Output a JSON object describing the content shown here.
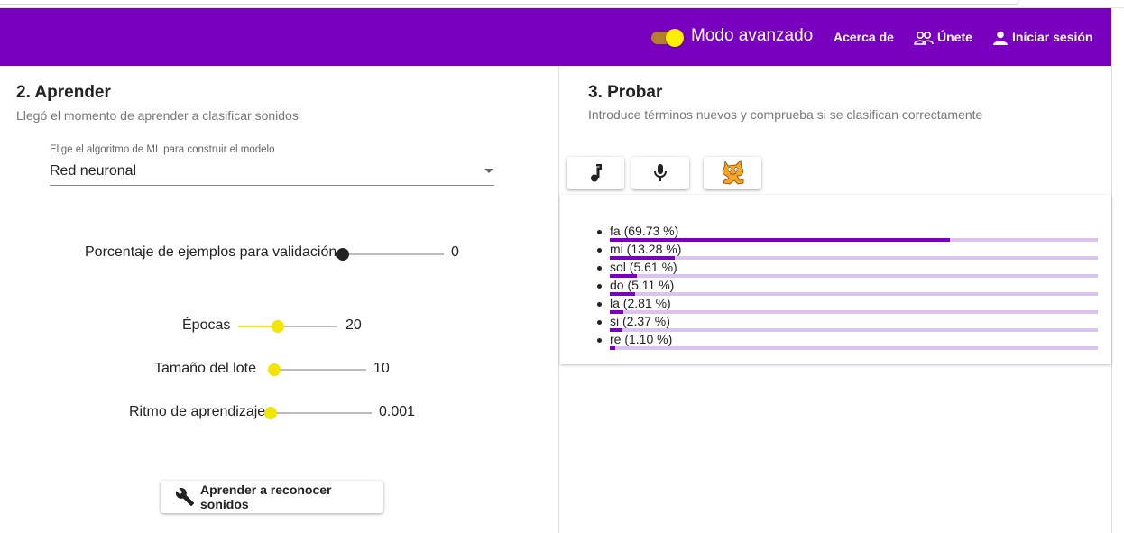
{
  "header": {
    "mode_label": "Modo avanzado",
    "mode_enabled": true,
    "about_label": "Acerca de",
    "join_label": "Únete",
    "login_label": "Iniciar sesión",
    "accent_color": "#7a00bf",
    "toggle_color": "#ffee00"
  },
  "learn": {
    "title": "2. Aprender",
    "subtitle": "Llegó el momento de aprender a clasificar sonidos",
    "algorithm_label": "Elige el algoritmo de ML para construir el modelo",
    "algorithm_value": "Red neuronal",
    "validation": {
      "label": "Porcentaje de ejemplos para validación",
      "value": "0",
      "fraction": 0.0
    },
    "epochs": {
      "label": "Épocas",
      "value": "20",
      "fraction": 0.4
    },
    "batch_size": {
      "label": "Tamaño del lote",
      "value": "10",
      "fraction": 0.0
    },
    "learning_rate": {
      "label": "Ritmo de aprendizaje",
      "value": "0.001",
      "fraction": 0.0
    },
    "train_button": "Aprender a reconocer sonidos"
  },
  "test": {
    "title": "3. Probar",
    "subtitle": "Introduce términos nuevos y comprueba si se clasifican correctamente",
    "buttons": [
      "music-note",
      "microphone",
      "scratch-cat"
    ],
    "results": [
      {
        "label": "fa (69.73 %)",
        "value": 69.73
      },
      {
        "label": "mi (13.28 %)",
        "value": 13.28
      },
      {
        "label": "sol (5.61 %)",
        "value": 5.61
      },
      {
        "label": "do (5.11 %)",
        "value": 5.11
      },
      {
        "label": "la (2.81 %)",
        "value": 2.81
      },
      {
        "label": "si (2.37 %)",
        "value": 2.37
      },
      {
        "label": "re (1.10 %)",
        "value": 1.1
      }
    ]
  }
}
